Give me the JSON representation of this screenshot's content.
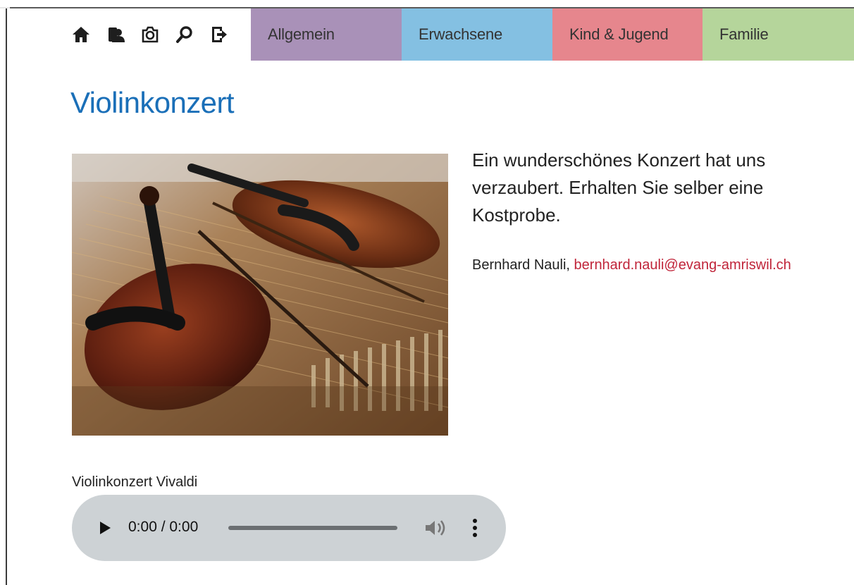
{
  "colors": {
    "title_blue": "#1a6fb8",
    "link_red": "#c0253a",
    "tab_allgemein": "#a991b8",
    "tab_erwachsene": "#84c0e2",
    "tab_kind": "#e6868d",
    "tab_familie": "#b5d59b",
    "icon_dark": "#1e1e1e",
    "audio_bg": "#cdd2d5"
  },
  "nav": {
    "icons": [
      "home-icon",
      "contact-person-icon",
      "camera-icon",
      "search-icon",
      "logout-icon"
    ],
    "tabs": {
      "allgemein": "Allgemein",
      "erwachsene": "Erwachsene",
      "kind": "Kind & Jugend",
      "familie": "Familie"
    }
  },
  "page": {
    "title": "Violinkonzert",
    "intro": "Ein wunderschönes Konzert hat uns verzaubert. Erhalten Sie selber eine Kostprobe.",
    "contact_name": "Bernhard Nauli,",
    "contact_email": "bernhard.nauli@evang-amriswil.ch"
  },
  "audio": {
    "label": "Violinkonzert Vivaldi",
    "time": "0:00 / 0:00",
    "progress": 0
  }
}
